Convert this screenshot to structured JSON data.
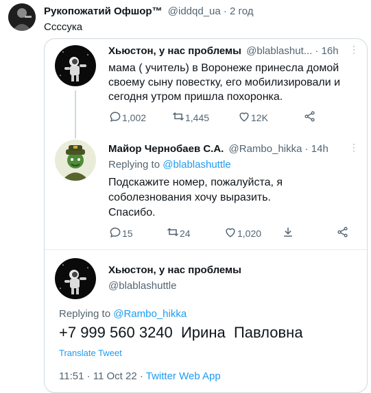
{
  "post": {
    "author_name": "Рукопожатий Офшор™",
    "handle_time": "@iddqd_ua · 2 год",
    "text": "Ссссука"
  },
  "tweets": [
    {
      "author_name": "Хьюстон, у нас проблемы",
      "handle": "@blablashut... · 16h",
      "text_lines": [
        "мама ( учитель) в Воронеже принесла домой",
        "своему сыну повестку, его  мобилизировали и",
        "сегодня утром пришла похоронка."
      ],
      "actions": {
        "reply": "1,002",
        "retweet": "1,445",
        "like": "12K"
      }
    },
    {
      "author_name": "Майор Чернобаев С.А.",
      "handle": "@Rambo_hikka · 14h",
      "replying_label": "Replying to ",
      "replying_to": "@blablashuttle",
      "text_lines": [
        "Подскажите номер, пожалуйста, я",
        "соболезнования хочу выразить.",
        "Спасибо."
      ],
      "actions": {
        "reply": "15",
        "retweet": "24",
        "like": "1,020"
      }
    },
    {
      "author_name": "Хьюстон, у нас проблемы",
      "handle": "@blablashuttle",
      "replying_label": "Replying to ",
      "replying_to": "@Rambo_hikka",
      "text": "+7 999 560 3240  Ирина  Павловна",
      "translate": "Translate Tweet",
      "time": "11:51 · 11 Oct 22 · ",
      "source": "Twitter Web App"
    }
  ],
  "colors": {
    "accent": "#1d9bf0",
    "muted": "#536471",
    "border": "#cfd9de"
  },
  "icons": [
    "reply-icon",
    "retweet-icon",
    "like-icon",
    "share-icon",
    "more-icon"
  ]
}
